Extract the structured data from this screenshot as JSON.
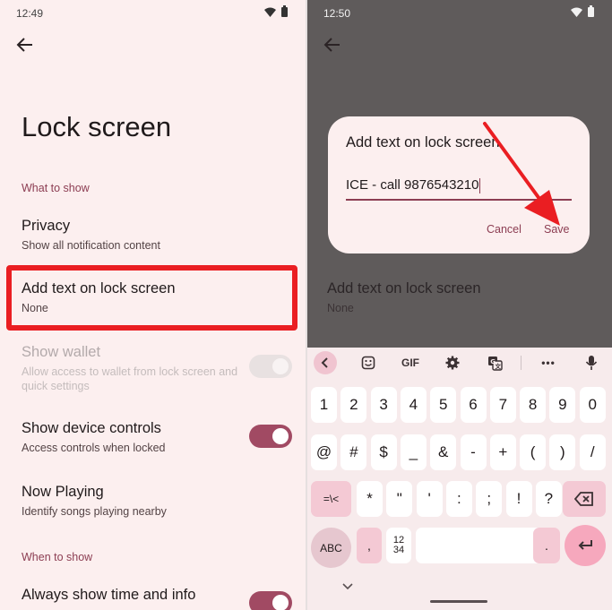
{
  "left": {
    "status_time": "12:49",
    "page_title": "Lock screen",
    "section_what": "What to show",
    "privacy_title": "Privacy",
    "privacy_sub": "Show all notification content",
    "addtext_title": "Add text on lock screen",
    "addtext_sub": "None",
    "wallet_title": "Show wallet",
    "wallet_sub": "Allow access to wallet from lock screen and quick settings",
    "wallet_toggle": "off",
    "device_title": "Show device controls",
    "device_sub": "Access controls when locked",
    "device_toggle": "on",
    "nowplaying_title": "Now Playing",
    "nowplaying_sub": "Identify songs playing nearby",
    "section_when": "When to show",
    "always_title": "Always show time and info",
    "always_toggle": "on"
  },
  "right": {
    "status_time": "12:50",
    "bg_addtext_title": "Add text on lock screen",
    "bg_addtext_sub": "None",
    "dialog": {
      "title": "Add text on lock screen",
      "field_value": "ICE - call 9876543210",
      "cancel_label": "Cancel",
      "save_label": "Save"
    },
    "keyboard": {
      "toolbar": [
        "chevron-left-icon",
        "sticker-icon",
        "GIF",
        "gear-icon",
        "translate-icon",
        "more-icon",
        "mic-icon"
      ],
      "gif_label": "GIF",
      "more_label": "•••",
      "row1": [
        "1",
        "2",
        "3",
        "4",
        "5",
        "6",
        "7",
        "8",
        "9",
        "0"
      ],
      "row2": [
        "@",
        "#",
        "$",
        "_",
        "&",
        "-",
        "+",
        "(",
        ")",
        "/"
      ],
      "row3": [
        "=\\<",
        "*",
        "\"",
        "'",
        ":",
        ";",
        "!",
        "?"
      ],
      "abc_label": "ABC",
      "comma": ",",
      "numpad_label": "12\n34",
      "period": "."
    }
  },
  "colors": {
    "accent": "#8c3d52",
    "toggle_on": "#a14a63",
    "highlight_red": "#ea1e22",
    "background": "#fcefef",
    "scrim": "#5f5b5b"
  }
}
